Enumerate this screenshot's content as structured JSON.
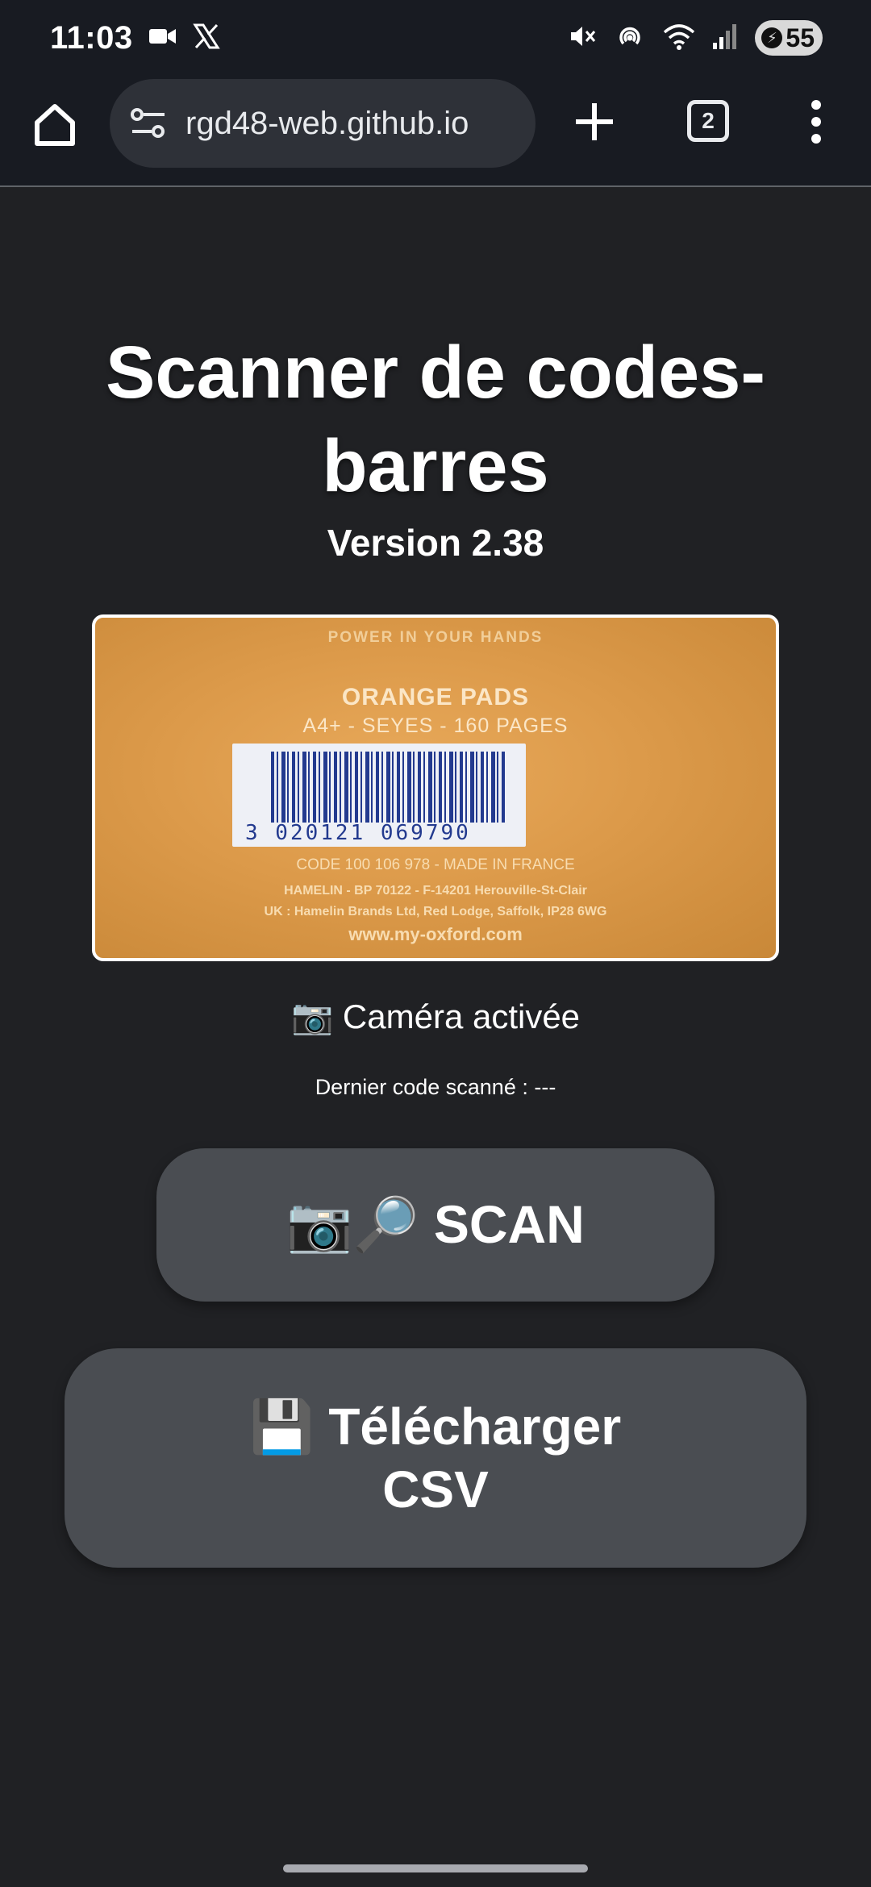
{
  "status_bar": {
    "time": "11:03",
    "battery": "55"
  },
  "browser": {
    "url": "rgd48-web.github.io",
    "tab_count": "2"
  },
  "page": {
    "title": "Scanner de codes-barres",
    "version": "Version 2.38",
    "camera_preview": {
      "top_text": "POWER IN YOUR HANDS",
      "product_name": "ORANGE PADS",
      "product_sub": "A4+ - SEYES - 160 PAGES",
      "barcode_digits": "3 020121 069790",
      "code_line": "CODE 100 106 978 - MADE IN FRANCE",
      "address_line1": "HAMELIN - BP 70122 - F-14201 Herouville-St-Clair",
      "address_line2": "UK : Hamelin Brands Ltd, Red Lodge, Saffolk, IP28 6WG",
      "website": "www.my-oxford.com"
    },
    "camera_status": "📷 Caméra activée",
    "last_code": "Dernier code scanné : ---",
    "scan_button": "📷🔎 SCAN",
    "download_button": "💾 Télécharger CSV"
  },
  "colors": {
    "background": "#202124",
    "toolbar": "#181b22",
    "button": "#4a4d52",
    "barcode_ink": "#233a8f"
  }
}
